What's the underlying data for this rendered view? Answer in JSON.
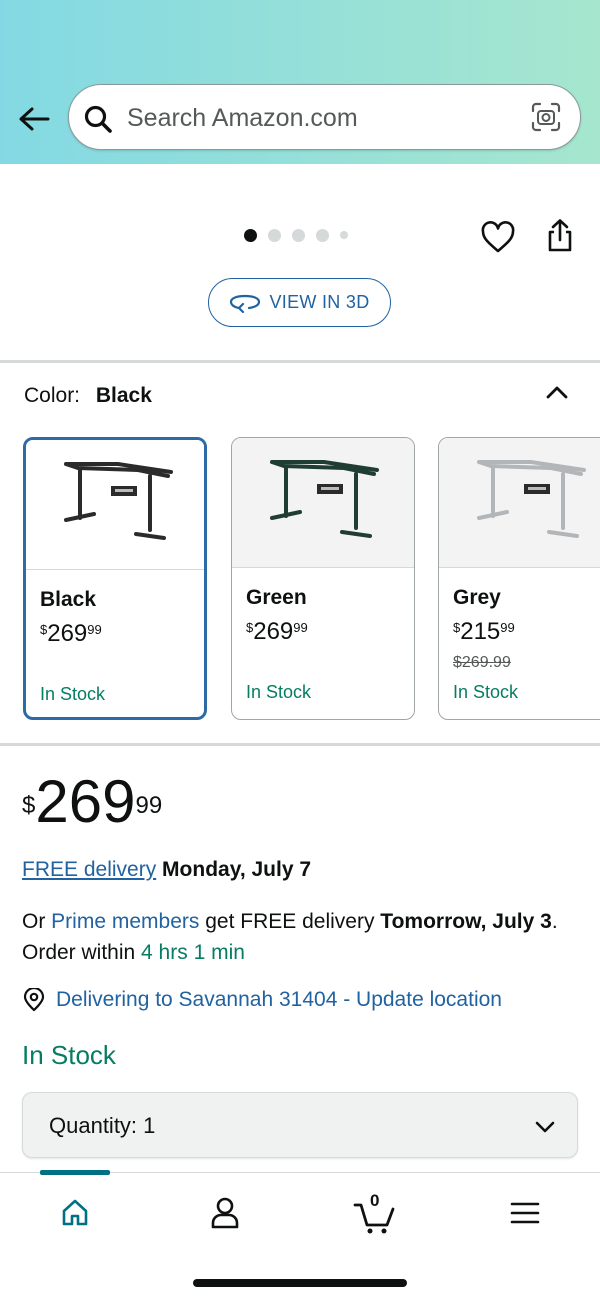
{
  "header": {
    "search_placeholder": "Search Amazon.com",
    "gradient_start": "#83d9e3",
    "gradient_end": "#a6e6ce"
  },
  "gallery": {
    "image_count": 5,
    "active_index": 0,
    "view3d_label": "VIEW IN 3D"
  },
  "color": {
    "label": "Color:",
    "selected": "Black",
    "swatches": [
      {
        "name": "Black",
        "price_dollars": "269",
        "price_cents": "99",
        "list_price": "",
        "stock": "In Stock",
        "selected": true,
        "frame_color": "#2b2b2b"
      },
      {
        "name": "Green",
        "price_dollars": "269",
        "price_cents": "99",
        "list_price": "",
        "stock": "In Stock",
        "selected": false,
        "frame_color": "#1f3d33"
      },
      {
        "name": "Grey",
        "price_dollars": "215",
        "price_cents": "99",
        "list_price": "$269.99",
        "stock": "In Stock",
        "selected": false,
        "frame_color": "#b3b6b8"
      }
    ]
  },
  "price": {
    "currency": "$",
    "dollars": "269",
    "cents": "99"
  },
  "delivery": {
    "free_delivery_link": "FREE delivery",
    "date": "Monday, July 7",
    "prime_prefix": "Or",
    "prime_link": "Prime members",
    "prime_middle": "get FREE delivery",
    "prime_date": "Tomorrow, July 3",
    "order_within_prefix": ". Order within",
    "order_within_time": "4 hrs 1 min",
    "location": "Delivering to Savannah 31404 - Update location"
  },
  "stock_status": "In Stock",
  "quantity": {
    "label": "Quantity:",
    "value": "1"
  },
  "bottom_nav": {
    "cart_count": "0",
    "accent": "#007185"
  },
  "colors": {
    "link": "#2162a1",
    "stock_green": "#067d62",
    "selected_border": "#2d6aa6"
  }
}
